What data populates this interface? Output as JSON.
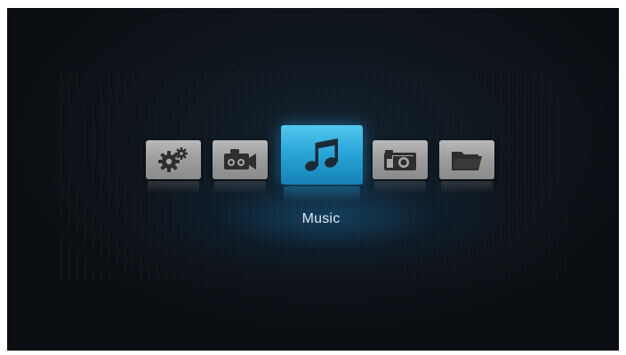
{
  "menu": {
    "items": [
      {
        "name": "settings",
        "icon": "gears-icon"
      },
      {
        "name": "video",
        "icon": "video-camera-icon"
      },
      {
        "name": "music",
        "icon": "music-note-icon",
        "selected": true
      },
      {
        "name": "photo",
        "icon": "camera-icon"
      },
      {
        "name": "files",
        "icon": "folder-icon"
      }
    ],
    "selected_label": "Music"
  },
  "colors": {
    "selected_tile": "#2aa7da",
    "tile": "#a8a8a8",
    "icon_dark": "#2e2e2e",
    "background": "#0e151c"
  }
}
